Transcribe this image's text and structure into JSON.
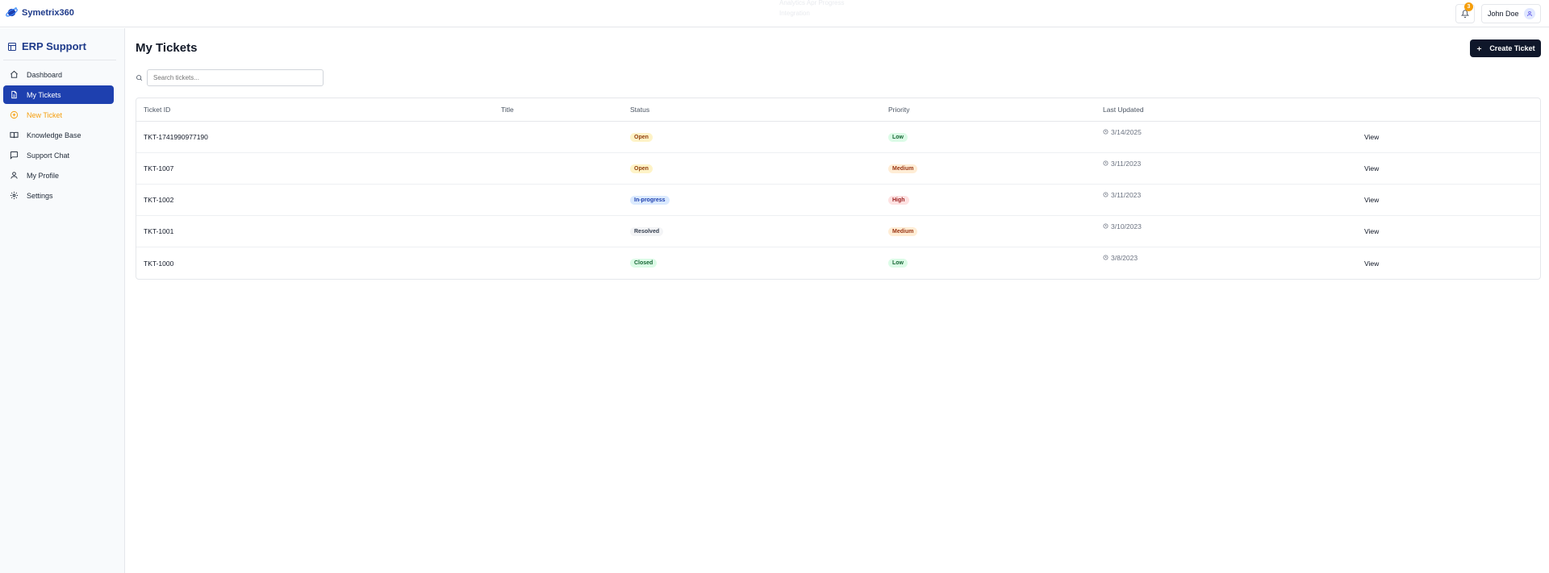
{
  "app": {
    "name": "Symetrix360"
  },
  "ghost_text": {
    "line1": "Analytics Apr Progress",
    "line2": "Integration"
  },
  "header": {
    "notification_count": "3",
    "user_name": "John Doe"
  },
  "sidebar": {
    "title": "ERP Support",
    "items": [
      {
        "label": "Dashboard",
        "icon": "home-icon"
      },
      {
        "label": "My Tickets",
        "icon": "document-icon",
        "active": true
      },
      {
        "label": "New Ticket",
        "icon": "plus-circle-icon"
      },
      {
        "label": "Knowledge Base",
        "icon": "book-icon"
      },
      {
        "label": "Support Chat",
        "icon": "chat-icon"
      },
      {
        "label": "My Profile",
        "icon": "user-icon"
      },
      {
        "label": "Settings",
        "icon": "gear-icon"
      }
    ]
  },
  "main": {
    "title": "My Tickets",
    "create_button": "Create Ticket",
    "search_placeholder": "Search tickets..."
  },
  "table": {
    "columns": [
      "Ticket ID",
      "Title",
      "Status",
      "Priority",
      "Last Updated"
    ],
    "rows": [
      {
        "id": "TKT-1741990977190",
        "title": "",
        "status": "Open",
        "priority": "Low",
        "updated": "3/14/2025",
        "action": "View"
      },
      {
        "id": "TKT-1007",
        "title": "",
        "status": "Open",
        "priority": "Medium",
        "updated": "3/11/2023",
        "action": "View"
      },
      {
        "id": "TKT-1002",
        "title": "",
        "status": "In-progress",
        "priority": "High",
        "updated": "3/11/2023",
        "action": "View"
      },
      {
        "id": "TKT-1001",
        "title": "",
        "status": "Resolved",
        "priority": "Medium",
        "updated": "3/10/2023",
        "action": "View"
      },
      {
        "id": "TKT-1000",
        "title": "",
        "status": "Closed",
        "priority": "Low",
        "updated": "3/8/2023",
        "action": "View"
      }
    ]
  },
  "colors": {
    "brand": "#1e3a8a",
    "active_nav": "#1e40af",
    "accent": "#f59e0b",
    "button_dark": "#0f172a"
  }
}
